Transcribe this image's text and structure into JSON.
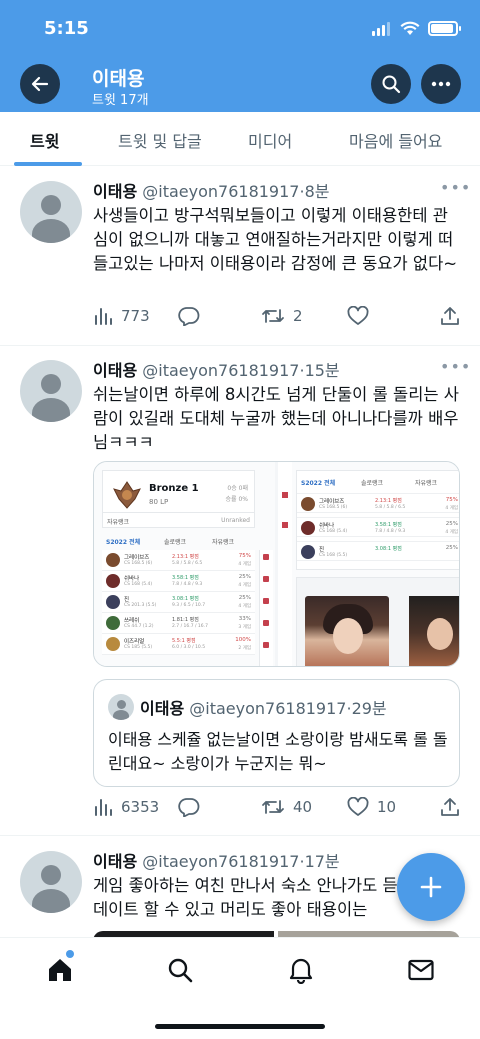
{
  "status_bar": {
    "time": "5:15"
  },
  "header": {
    "title": "이태용",
    "subtitle": "트윗 17개"
  },
  "tabs": [
    {
      "label": "트윗",
      "active": true
    },
    {
      "label": "트윗 및 답글",
      "active": false
    },
    {
      "label": "미디어",
      "active": false
    },
    {
      "label": "마음에 들어요",
      "active": false
    }
  ],
  "tweets": [
    {
      "name": "이태용",
      "handle": "@itaeyon76181917",
      "dot": "·",
      "time": "8분",
      "text": "사생들이고 방구석뭐보들이고 이렇게 이태용한테 관심이 없으니까 대놓고 연애질하는거라지만 이렇게 떠들고있는 나마저 이태용이라 감정에 큰 동요가 없다~",
      "views": "773",
      "replies": "",
      "retweets": "2",
      "likes": ""
    },
    {
      "name": "이태용",
      "handle": "@itaeyon76181917",
      "dot": "·",
      "time": "15분",
      "text": "쉬는날이면 하루에 8시간도 넘게 단둘이 롤 돌리는 사람이 있길래 도대체 누굴까 했는데 아니나다를까 배우님ㅋㅋㅋ",
      "views": "6353",
      "replies": "",
      "retweets": "40",
      "likes": "10",
      "media": {
        "rank_tier": "Bronze 1",
        "rank_lp": "80 LP",
        "rank_wins": "0승 0패",
        "rank_winrate": "승률 0%",
        "flex_label": "자유랭크",
        "flex_status": "Unranked",
        "season_tab": "S2022 전체",
        "solo_tab": "솔로랭크",
        "flex_tab": "자유랭크",
        "champions": [
          {
            "name": "그레이브즈",
            "cs": "CS 168.5 (6)",
            "kda": "2.13:1 평점",
            "kda_detail": "5.8 / 5.8 / 6.5",
            "winrate": "75%",
            "games": "4 게임",
            "color": "#7a4b2e"
          },
          {
            "name": "쉬바나",
            "cs": "CS 168 (5.4)",
            "kda": "3.58:1 평점",
            "kda_detail": "7.8 / 4.8 / 9.3",
            "winrate": "25%",
            "games": "4 게임",
            "color": "#6e2c2a"
          },
          {
            "name": "진",
            "cs": "CS 201.3 (5.5)",
            "kda": "3.08:1 평점",
            "kda_detail": "9.3 / 6.5 / 10.7",
            "winrate": "25%",
            "games": "4 게임",
            "color": "#3b3f5c"
          },
          {
            "name": "쓰레쉬",
            "cs": "CS 44.7 (1.2)",
            "kda": "1.81:1 평점",
            "kda_detail": "2.7 / 16.7 / 16.7",
            "winrate": "33%",
            "games": "3 게임",
            "color": "#3f6b3a"
          },
          {
            "name": "이즈리얼",
            "cs": "CS 185 (5.5)",
            "kda": "5.5:1 평점",
            "kda_detail": "6.0 / 3.0 / 10.5",
            "winrate": "100%",
            "games": "2 게임",
            "color": "#b88a3e"
          }
        ],
        "right_champions": [
          {
            "name": "그레이브즈",
            "cs": "CS 168.5 (6)",
            "kda": "2.13:1 평점",
            "kda_detail": "5.8 / 5.8 / 6.5",
            "winrate": "75%",
            "games": "4 게임",
            "color": "#7a4b2e"
          },
          {
            "name": "쉬바나",
            "cs": "CS 168 (5.4)",
            "kda": "3.58:1 평점",
            "kda_detail": "7.8 / 4.8 / 9.3",
            "winrate": "25%",
            "games": "4 게임",
            "color": "#6e2c2a"
          },
          {
            "name": "진",
            "cs": "CS 168 (5.5)",
            "kda": "3.08:1 평점",
            "kda_detail": "",
            "winrate": "25%",
            "games": "",
            "color": "#3b3f5c"
          }
        ]
      },
      "quote": {
        "name": "이태용",
        "handle": "@itaeyon76181917",
        "dot": "·",
        "time": "29분",
        "text": "이태용 스케쥴 없는날이면 소랑이랑 밤새도록 롤 돌린대요~ 소랑이가 누군지는 뭐~"
      }
    },
    {
      "name": "이태용",
      "handle": "@itaeyon76181917",
      "dot": "·",
      "time": "17분",
      "text": "게임 좋아하는 여친 만나서 숙소 안나가도 듣고 데이트 할 수 있고 머리도 좋아 태용이는"
    }
  ],
  "icons": {
    "back": "arrow-left-icon",
    "search": "search-icon",
    "more": "more-horizontal-icon",
    "views": "bar-chart-icon",
    "reply": "reply-icon",
    "retweet": "retweet-icon",
    "like": "heart-icon",
    "share": "share-icon",
    "compose": "plus-icon",
    "nav_home": "home-icon",
    "nav_search": "search-icon",
    "nav_notifications": "bell-icon",
    "nav_messages": "mail-icon"
  },
  "colors": {
    "brand": "#4c9be8",
    "text": "#0f1419",
    "muted": "#536471"
  }
}
